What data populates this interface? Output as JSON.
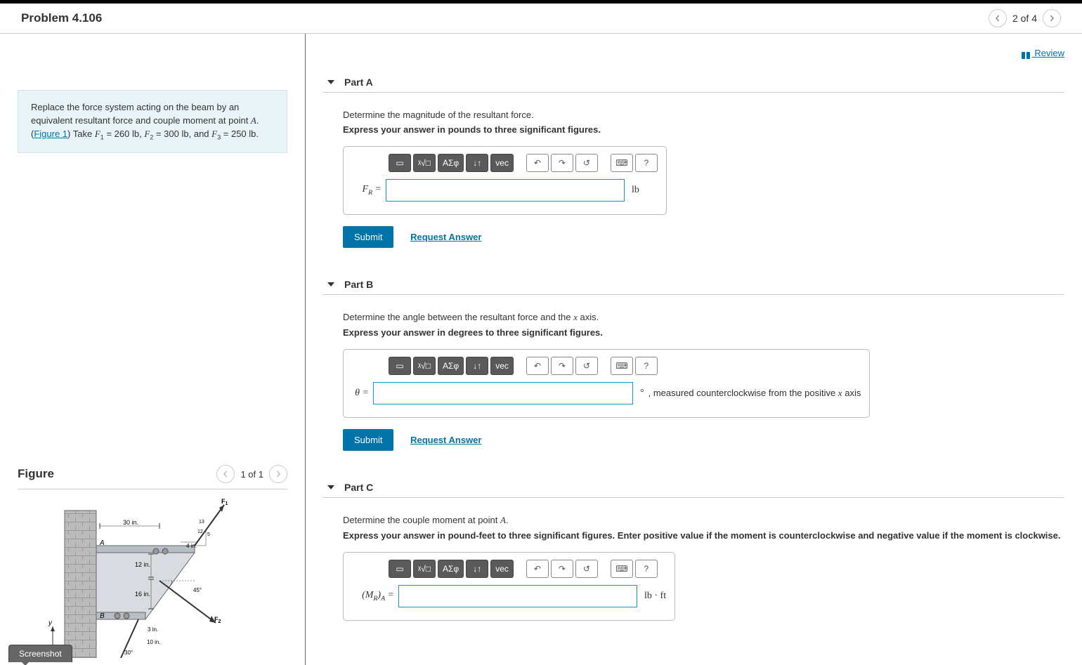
{
  "header": {
    "title": "Problem 4.106",
    "counter": "2 of 4"
  },
  "review": {
    "label": " Review"
  },
  "problem": {
    "text_1": "Replace the force system acting on the beam by an equivalent resultant force and couple moment at point ",
    "point": "A",
    "figure_link": "Figure 1",
    "text_2": " Take ",
    "f1_var": "F",
    "f1_sub": "1",
    "f1_eq": " = 260 ",
    "unit_lb": "lb",
    "f2_var": "F",
    "f2_sub": "2",
    "f2_eq": " = 300 ",
    "f3_var": "F",
    "f3_sub": "3",
    "f3_eq": " = 250 "
  },
  "figure": {
    "title": "Figure",
    "counter": "1 of 1"
  },
  "figure_labels": {
    "d30": "30 in.",
    "d4": "4 in.",
    "d12": "12 in.",
    "d16": "16 in.",
    "d3": "3 in.",
    "d10": "10 in.",
    "a45": "45°",
    "a30": "30°",
    "r13": "13",
    "r12": "12",
    "r5": "5",
    "A": "A",
    "B": "B",
    "y": "y",
    "F1": "F",
    "F1s": "1",
    "F2": "F",
    "F2s": "2"
  },
  "toolbar": {
    "tmpl": "▭",
    "sqrt": "ᵡ√□",
    "greek": "ΑΣφ",
    "subsup": "↓↑",
    "vec": "vec",
    "undo": "↶",
    "redo": "↷",
    "reset": "↺",
    "kbd": "⌨",
    "help": "?"
  },
  "partA": {
    "title": "Part A",
    "instr": "Determine the magnitude of the resultant force.",
    "instr2": "Express your answer in pounds to three significant figures.",
    "var": "F",
    "var_sub": "R",
    "eq": " = ",
    "unit": "lb"
  },
  "partB": {
    "title": "Part B",
    "instr_pre": "Determine the angle between the resultant force and the ",
    "instr_x": "x",
    "instr_post": " axis.",
    "instr2": "Express your answer in degrees to three significant figures.",
    "var": "θ",
    "eq": " = ",
    "unit": "°",
    "note_pre": ", measured counterclockwise from the positive ",
    "note_x": "x",
    "note_post": " axis"
  },
  "partC": {
    "title": "Part C",
    "instr_pre": "Determine the couple moment at point ",
    "instr_A": "A",
    "instr_post": ".",
    "instr2": "Express your answer in pound-feet to three significant figures. Enter positive value if the moment is counterclockwise and negative value if the moment is clockwise.",
    "var_pre": "(",
    "var": "M",
    "var_sub": "R",
    "var_post": ")",
    "var_sub2": "A",
    "eq": " = ",
    "unit": "lb · ft"
  },
  "actions": {
    "submit": "Submit",
    "request": "Request Answer"
  },
  "screenshot": "Screenshot"
}
